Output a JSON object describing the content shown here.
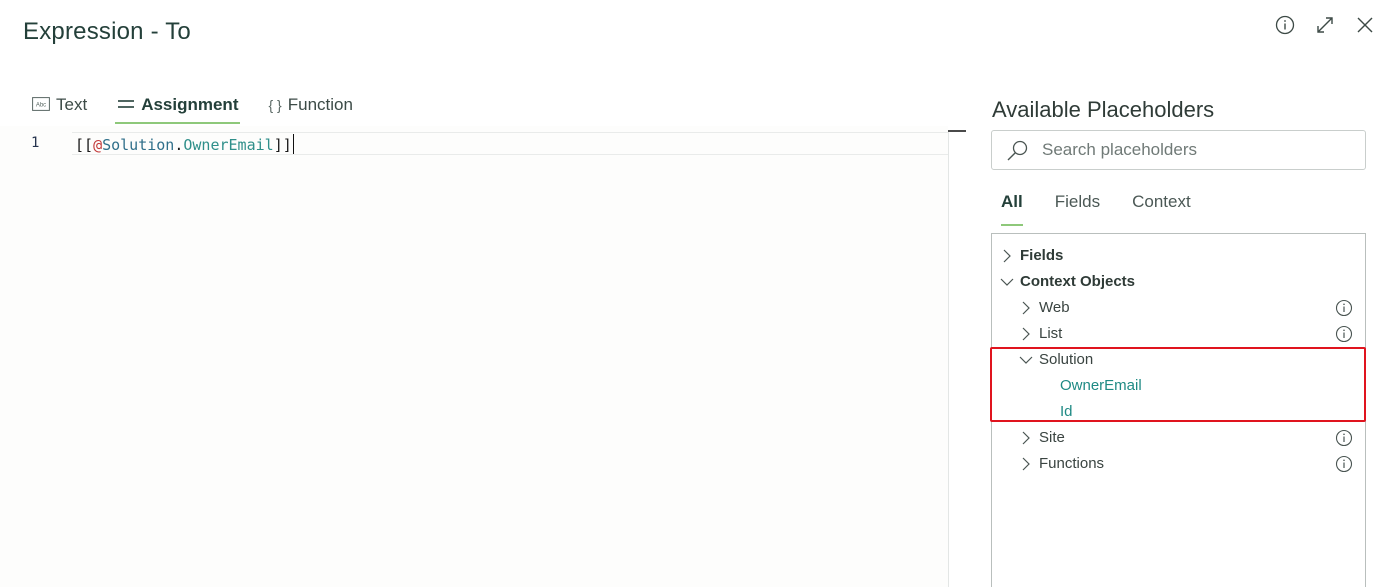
{
  "dialog": {
    "title": "Expression - To"
  },
  "mode_tabs": [
    {
      "label": "Text",
      "icon": "text-icon"
    },
    {
      "label": "Assignment",
      "icon": "assignment-icon",
      "active": true
    },
    {
      "label": "Function",
      "icon": "braces-icon"
    }
  ],
  "mode_tab_glyphs": {
    "text": "Abc",
    "function": "{ }"
  },
  "editor": {
    "line_number": "1",
    "code_open": "[[",
    "code_at": "@",
    "code_ns": "Solution",
    "code_dot": ".",
    "code_member": "OwnerEmail",
    "code_close": "]]"
  },
  "placeholders": {
    "title": "Available Placeholders",
    "search_placeholder": "Search placeholders",
    "filter_tabs": [
      {
        "label": "All",
        "active": true
      },
      {
        "label": "Fields"
      },
      {
        "label": "Context"
      }
    ],
    "tree": {
      "fields": "Fields",
      "context_objects": "Context Objects",
      "web": "Web",
      "list": "List",
      "solution": "Solution",
      "owner_email": "OwnerEmail",
      "id": "Id",
      "site": "Site",
      "functions": "Functions"
    }
  },
  "colors": {
    "accent_underline": "#8ec87a",
    "highlight": "#e0141e",
    "leaf_text": "#1f8a84"
  }
}
